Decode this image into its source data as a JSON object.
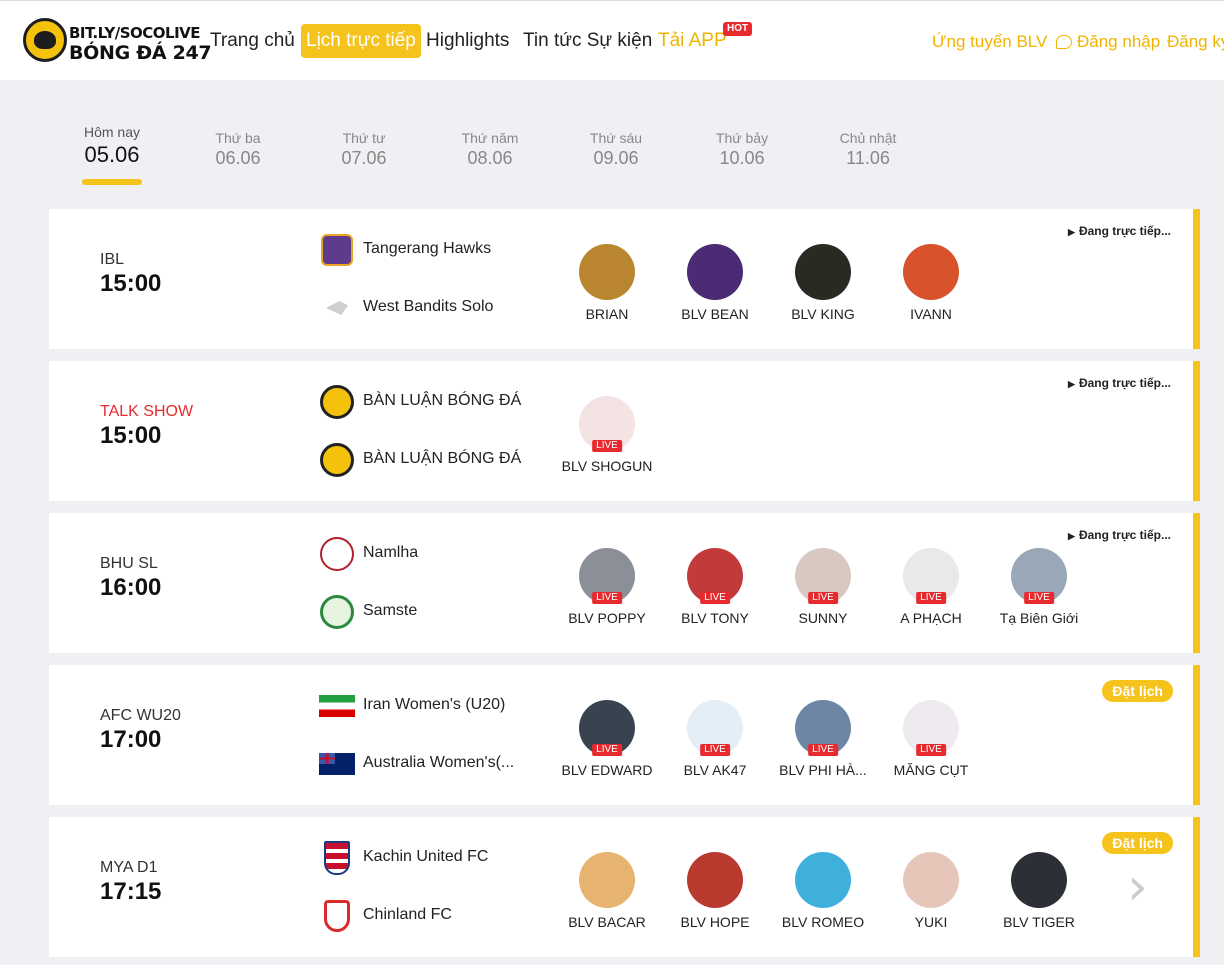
{
  "header": {
    "logo_line1": "BIT.LY/SOCOLIVE",
    "logo_line2": "BÓNG ĐÁ 247",
    "nav": [
      "Trang chủ",
      "Lịch trực tiếp",
      "Highlights",
      "Tin tức Sự kiện",
      "Tải APP"
    ],
    "hot_badge": "HOT",
    "apply_blv": "Ứng tuyển BLV",
    "login": "Đăng nhập",
    "register": "Đăng ký"
  },
  "date_tabs": [
    {
      "day": "Hôm nay",
      "date": "05.06"
    },
    {
      "day": "Thứ ba",
      "date": "06.06"
    },
    {
      "day": "Thứ tư",
      "date": "07.06"
    },
    {
      "day": "Thứ năm",
      "date": "08.06"
    },
    {
      "day": "Thứ sáu",
      "date": "09.06"
    },
    {
      "day": "Thứ bảy",
      "date": "10.06"
    },
    {
      "day": "Chủ nhật",
      "date": "11.06"
    }
  ],
  "matches": [
    {
      "league": "IBL",
      "time": "15:00",
      "status": "Đang trực tiếp...",
      "home": {
        "name": "Tangerang Hawks",
        "logo": "hawks-logo"
      },
      "away": {
        "name": "West Bandits Solo",
        "logo": "bandits-logo"
      },
      "commentators": [
        {
          "name": "BRIAN",
          "live": "",
          "color": "#b9862f"
        },
        {
          "name": "BLV BEAN",
          "live": "",
          "color": "#4a2b74"
        },
        {
          "name": "BLV KING",
          "live": "",
          "color": "#2a2a22"
        },
        {
          "name": "IVANN",
          "live": "",
          "color": "#d8522c"
        }
      ]
    },
    {
      "league": "TALK SHOW",
      "time": "15:00",
      "status": "Đang trực tiếp...",
      "home": {
        "name": "BÀN LUẬN BÓNG ĐÁ",
        "logo": "soco-logo"
      },
      "away": {
        "name": "BÀN LUẬN BÓNG ĐÁ",
        "logo": "soco-logo"
      },
      "commentators": [
        {
          "name": "BLV SHOGUN",
          "live": "LIVE",
          "color": "#f3e3e3"
        }
      ]
    },
    {
      "league": "BHU SL",
      "time": "16:00",
      "status": "Đang trực tiếp...",
      "home": {
        "name": "Namlha",
        "logo": "namlha-logo"
      },
      "away": {
        "name": "Samste",
        "logo": "samste-logo"
      },
      "commentators": [
        {
          "name": "BLV POPPY",
          "live": "LIVE",
          "color": "#8a8f98"
        },
        {
          "name": "BLV TONY",
          "live": "LIVE",
          "color": "#c23a3a"
        },
        {
          "name": "SUNNY",
          "live": "LIVE",
          "color": "#d9c7c2"
        },
        {
          "name": "A PHẠCH",
          "live": "LIVE",
          "color": "#e9e9e9"
        },
        {
          "name": "Tạ Biên Giới",
          "live": "LIVE",
          "color": "#9aa7b6"
        }
      ]
    },
    {
      "league": "AFC WU20",
      "time": "17:00",
      "status": "Đặt lịch",
      "home": {
        "name": "Iran Women's (U20)",
        "logo": "iran-flag"
      },
      "away": {
        "name": "Australia Women's(...",
        "logo": "australia-flag"
      },
      "commentators": [
        {
          "name": "BLV EDWARD",
          "live": "LIVE",
          "color": "#39424f"
        },
        {
          "name": "BLV AK47",
          "live": "LIVE",
          "color": "#e4eef6"
        },
        {
          "name": "BLV PHI HÀ...",
          "live": "LIVE",
          "color": "#6d86a6"
        },
        {
          "name": "MĂNG CỤT",
          "live": "LIVE",
          "color": "#efeaf0"
        }
      ]
    },
    {
      "league": "MYA D1",
      "time": "17:15",
      "status": "Đặt lịch",
      "home": {
        "name": "Kachin United FC",
        "logo": "kachin-logo"
      },
      "away": {
        "name": "Chinland FC",
        "logo": "chinland-logo"
      },
      "commentators": [
        {
          "name": "BLV BACAR",
          "live": "",
          "color": "#e7b470"
        },
        {
          "name": "BLV HOPE",
          "live": "",
          "color": "#b83a2f"
        },
        {
          "name": "BLV ROMEO",
          "live": "",
          "color": "#3fb0dc"
        },
        {
          "name": "YUKI",
          "live": "",
          "color": "#e6c6b8"
        },
        {
          "name": "BLV TIGER",
          "live": "",
          "color": "#2c2f36"
        }
      ]
    }
  ]
}
